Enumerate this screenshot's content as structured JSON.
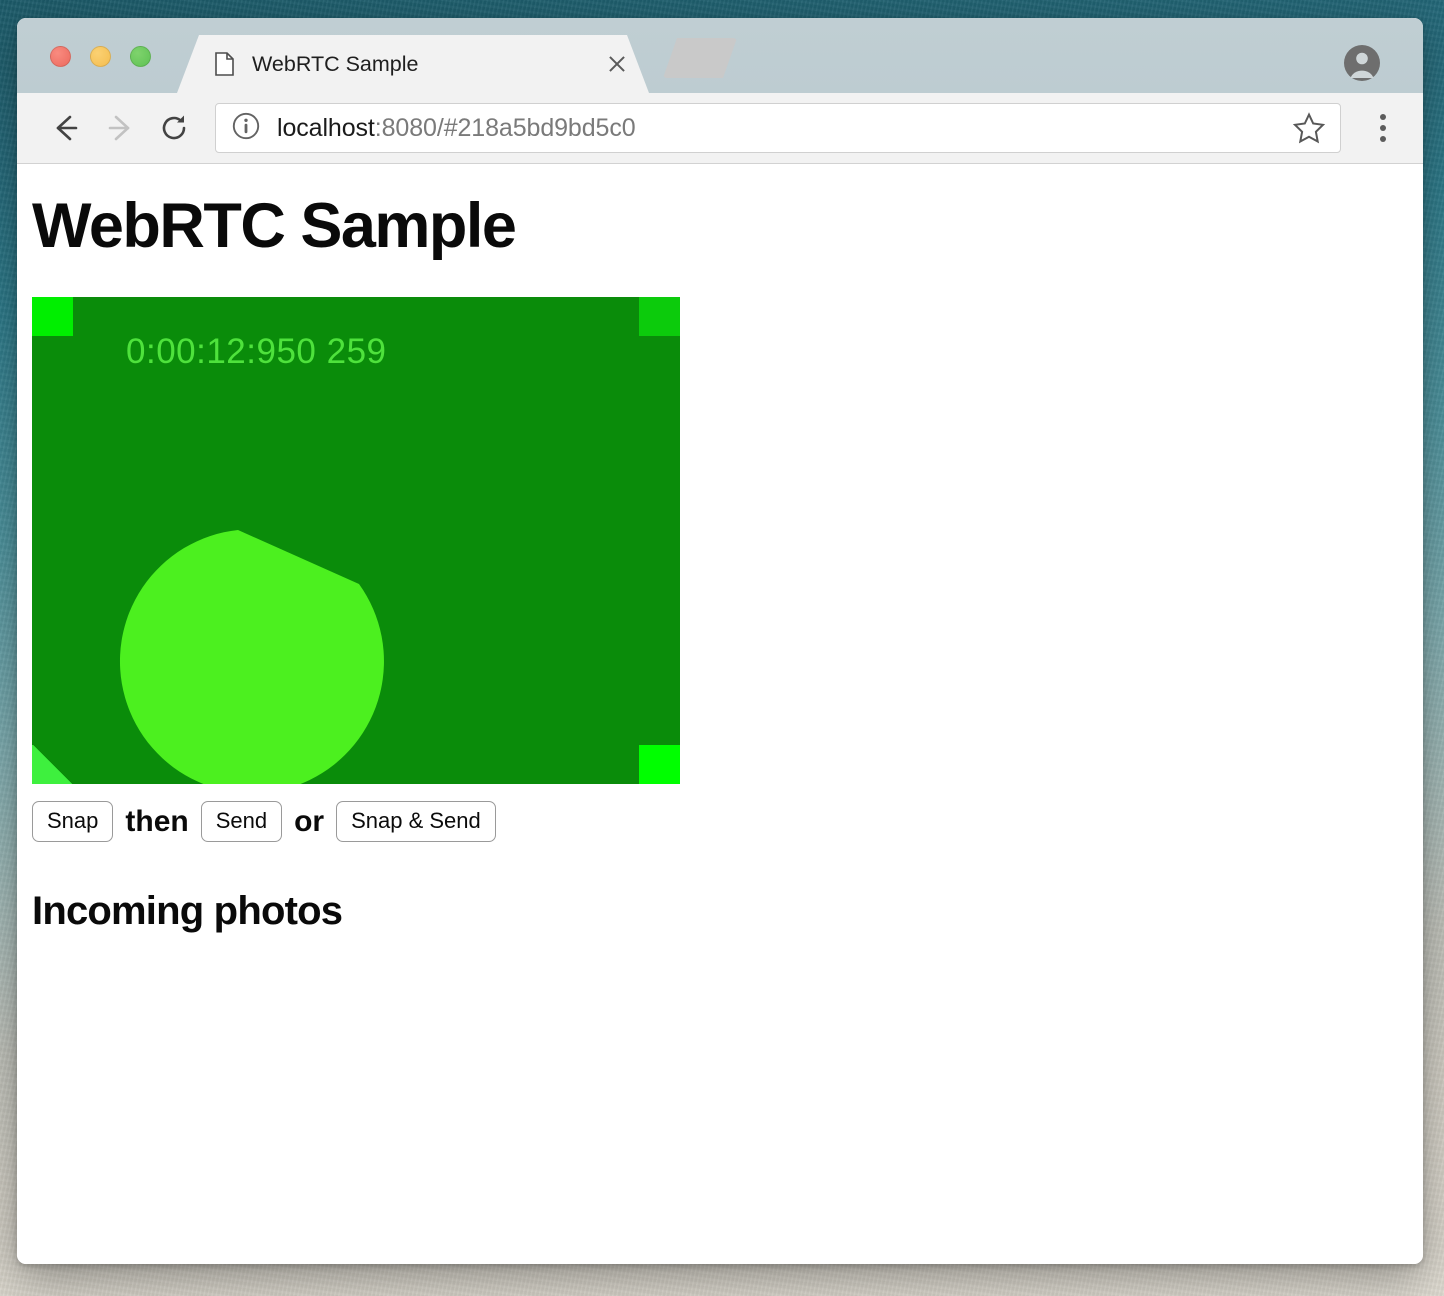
{
  "window": {
    "traffic_lights": [
      {
        "name": "close",
        "color": "#ec6a5e"
      },
      {
        "name": "minimize",
        "color": "#f4bd4f"
      },
      {
        "name": "zoom",
        "color": "#5fc254"
      }
    ]
  },
  "tab_strip": {
    "active_tab": {
      "title": "WebRTC Sample",
      "favicon": "document-icon",
      "close_icon": "close-icon"
    },
    "new_tab_icon": "new-tab-icon",
    "profile_icon": "profile-avatar-icon"
  },
  "toolbar": {
    "back_icon": "back-arrow-icon",
    "back_enabled": true,
    "forward_icon": "forward-arrow-icon",
    "forward_enabled": false,
    "reload_icon": "reload-icon",
    "info_icon": "info-circle-icon",
    "star_icon": "bookmark-star-icon",
    "menu_icon": "three-dot-menu-icon",
    "url": {
      "full": "localhost:8080/#218a5bd9bd5c0",
      "host": "localhost",
      "rest": ":8080/#218a5bd9bd5c0"
    }
  },
  "page": {
    "title": "WebRTC Sample",
    "video": {
      "timestamp": "0:00:12:950 259",
      "background_color": "#0a8c0a",
      "arc_color": "#4cf01f",
      "text_color": "#4ee23c",
      "corners": {
        "top_left_color": "#00ef00",
        "top_right_color": "#0ccb0c",
        "bottom_right_color": "#00ff00",
        "bottom_left_color": "#3ef03e"
      }
    },
    "controls": {
      "snap_label": "Snap",
      "then_label": "then",
      "send_label": "Send",
      "or_label": "or",
      "snap_and_send_label": "Snap & Send"
    },
    "incoming_section_title": "Incoming photos",
    "incoming_photos": []
  }
}
